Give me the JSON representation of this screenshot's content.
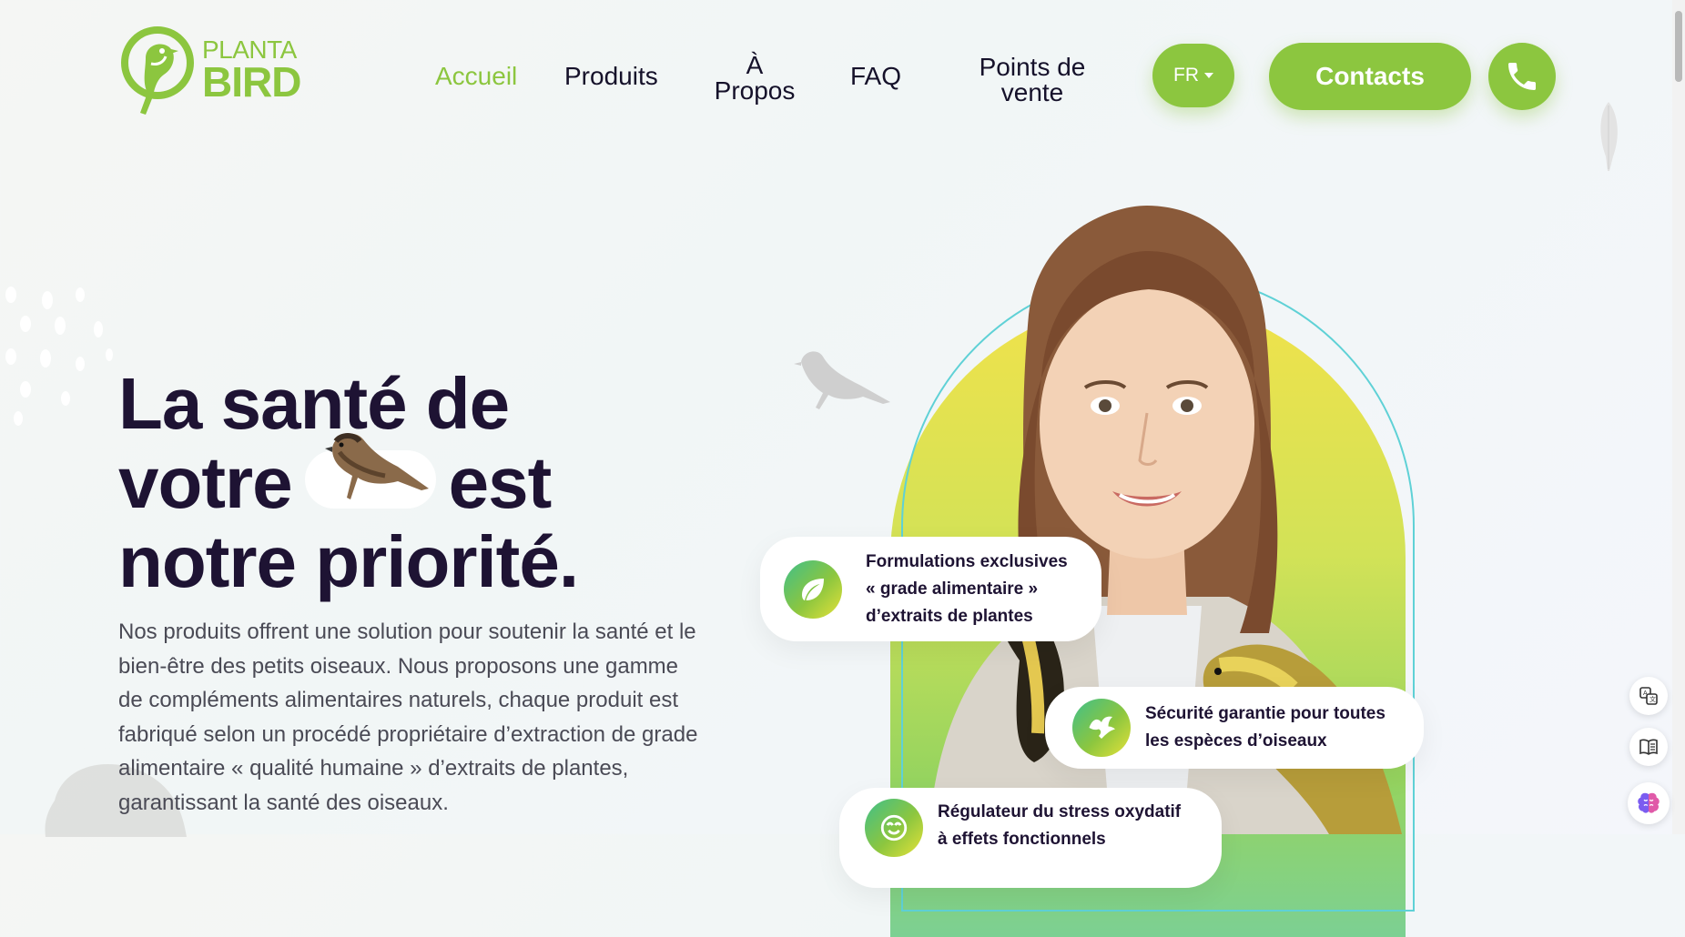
{
  "brand": {
    "line1": "PLANTA",
    "line2": "BIRD",
    "color": "#8cc63f"
  },
  "nav": {
    "items": [
      {
        "label": "Accueil",
        "active": true
      },
      {
        "label": "Produits"
      },
      {
        "label": "À",
        "label2": "Propos"
      },
      {
        "label": "FAQ"
      },
      {
        "label": "Points de",
        "label2": "vente"
      }
    ]
  },
  "header": {
    "lang": "FR",
    "contacts": "Contacts",
    "phone_icon": "phone-icon"
  },
  "hero": {
    "title_l1": "La santé de",
    "title_l2a": "votre",
    "title_l2b": "est",
    "title_l3": "notre priorité.",
    "description": "Nos produits offrent une solution pour soutenir la santé et le bien-être des petits oiseaux. Nous proposons une gamme de compléments alimentaires naturels, chaque produit est fabriqué selon un procédé propriétaire d’extraction de grade alimentaire « qualité humaine » d’extraits de plantes, garantissant la santé des oiseaux."
  },
  "features": [
    {
      "icon": "leaf-icon",
      "lines": [
        "Formulations exclusives",
        "« grade alimentaire »",
        "d’extraits de plantes"
      ]
    },
    {
      "icon": "dove-icon",
      "lines": [
        "Sécurité garantie pour toutes",
        "les espèces d’oiseaux"
      ]
    },
    {
      "icon": "smile-icon",
      "lines": [
        "Régulateur du stress oxydatif",
        "à effets fonctionnels"
      ]
    }
  ],
  "tools": [
    "translate-icon",
    "reader-icon",
    "brain-icon"
  ]
}
